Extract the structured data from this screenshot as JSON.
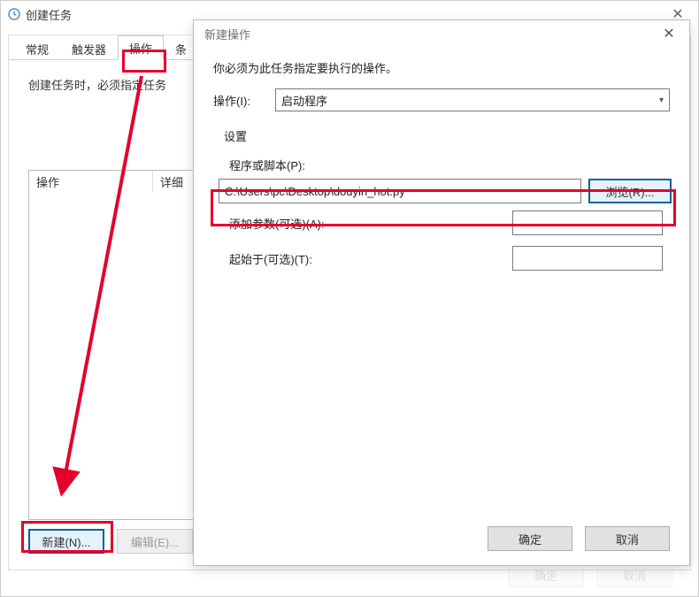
{
  "back_window": {
    "title": "创建任务",
    "tabs": {
      "general": "常规",
      "triggers": "触发器",
      "actions": "操作",
      "conditions_partial": "条"
    },
    "hint": "创建任务时，必须指定任务",
    "list": {
      "col_action": "操作",
      "col_detail": "详细"
    },
    "buttons": {
      "new": "新建(N)...",
      "edit": "编辑(E)..."
    }
  },
  "back_footer": {
    "ok_obscured": "确定",
    "cancel_obscured": "取消"
  },
  "front_window": {
    "title": "新建操作",
    "intro": "你必须为此任务指定要执行的操作。",
    "action_label": "操作(I):",
    "action_value": "启动程序",
    "settings_label": "设置",
    "script_label": "程序或脚本(P):",
    "script_value": "C:\\Users\\pc\\Desktop\\douyin_hot.py",
    "browse": "浏览(R)...",
    "args_label": "添加参数(可选)(A):",
    "args_value": "",
    "startin_label": "起始于(可选)(T):",
    "startin_value": "",
    "ok": "确定",
    "cancel": "取消"
  }
}
